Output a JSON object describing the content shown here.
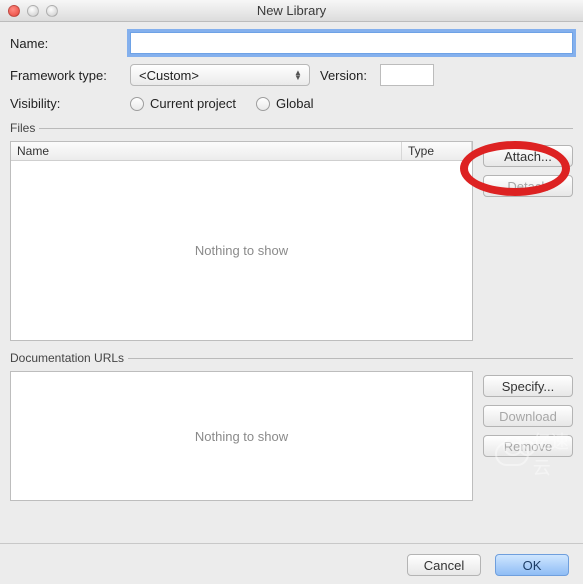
{
  "window": {
    "title": "New Library"
  },
  "form": {
    "name_label": "Name:",
    "name_value": "",
    "framework_label": "Framework type:",
    "framework_selected": "<Custom>",
    "version_label": "Version:",
    "version_value": "",
    "visibility_label": "Visibility:",
    "visibility_options": {
      "current": "Current project",
      "global": "Global"
    }
  },
  "files": {
    "legend": "Files",
    "columns": {
      "name": "Name",
      "type": "Type"
    },
    "empty_text": "Nothing to show",
    "buttons": {
      "attach": "Attach...",
      "detach": "Detach"
    }
  },
  "docs": {
    "legend": "Documentation URLs",
    "empty_text": "Nothing to show",
    "buttons": {
      "specify": "Specify...",
      "download": "Download",
      "remove": "Remove"
    }
  },
  "footer": {
    "cancel": "Cancel",
    "ok": "OK"
  },
  "watermark": "亿速云"
}
